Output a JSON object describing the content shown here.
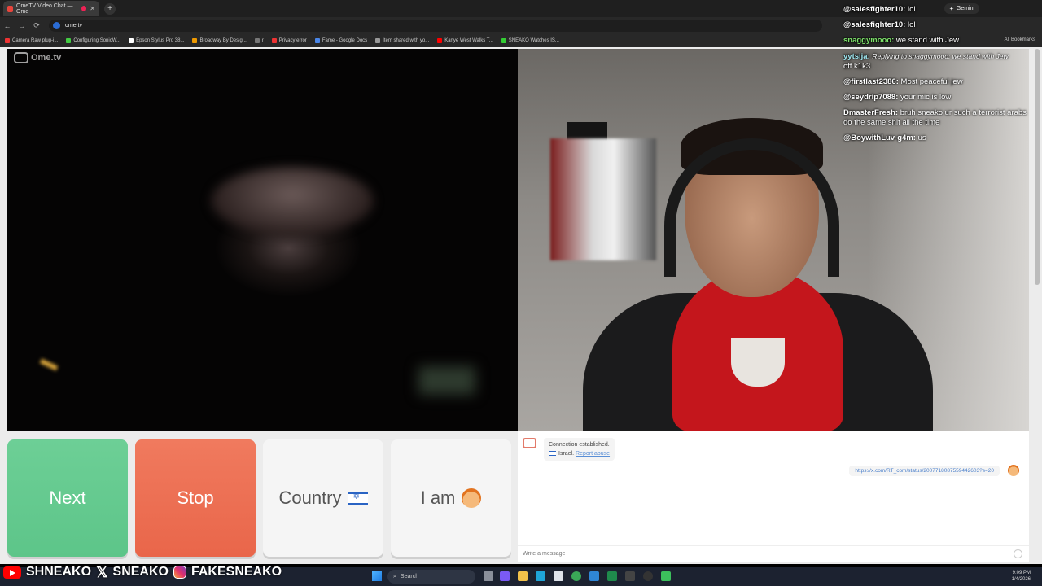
{
  "browser": {
    "tab_title": "OmeTV Video Chat — Ome",
    "tab_close": "✕",
    "new_tab": "+",
    "url": "ome.tv",
    "gemini_label": "Gemini",
    "nav": {
      "back": "←",
      "forward": "→",
      "reload": "⟳"
    },
    "bookmarks": [
      "Camera Raw plug-i...",
      "Configuring SonicW...",
      "Epson Stylus Pro 38...",
      "Broadway By Desig...",
      "r",
      "Privacy error",
      "Fame - Google Docs",
      "Item shared with yo...",
      "Kanye West Walks T...",
      "SNEAKO Watches IS..."
    ],
    "all_bookmarks": "All Bookmarks"
  },
  "site": {
    "logo_text": "Ome.tv"
  },
  "stream_chat": [
    {
      "user": "@salesfighter10:",
      "text": "lol",
      "color": "#ffffff"
    },
    {
      "user": "@salesfighter10:",
      "text": "lol",
      "color": "#ffffff"
    },
    {
      "user": "snaggymooo:",
      "text": "we stand with Jew",
      "color": "#7ee56b"
    },
    {
      "user": "yytsija:",
      "text": "Replying to snaggymooo: we stand with Jew",
      "extra": "off k1k3",
      "color": "#9fe7f0"
    },
    {
      "user": "@firstlast2386:",
      "text": "Most peaceful jew",
      "color": "#ffffff"
    },
    {
      "user": "@seydrip7088:",
      "text": "your mic is low",
      "color": "#ffffff"
    },
    {
      "user": "DmasterFresh:",
      "text": "bruh sneako ur such a terrorist arabs do the same shit all the time",
      "color": "#ffffff"
    },
    {
      "user": "@BoywithLuv-g4m:",
      "text": "us",
      "color": "#ffffff"
    }
  ],
  "controls": {
    "next_label": "Next",
    "stop_label": "Stop",
    "country_label": "Country",
    "iam_label": "I am"
  },
  "chat": {
    "system_line1": "Connection established.",
    "system_country": "Israel.",
    "report_link": "Report abuse",
    "outgoing_message": "https://x.com/RT_com/status/2007718087559442603?s=20",
    "input_placeholder": "Write a message"
  },
  "social": {
    "youtube": "SHNEAKO",
    "x": "SNEAKO",
    "instagram": "FAKESNEAKO"
  },
  "taskbar": {
    "search_placeholder": "Search",
    "time": "9:09 PM",
    "date": "1/4/2026"
  },
  "colors": {
    "next": "#62ca8f",
    "stop": "#ec6f53",
    "link": "#5a8fd6"
  }
}
